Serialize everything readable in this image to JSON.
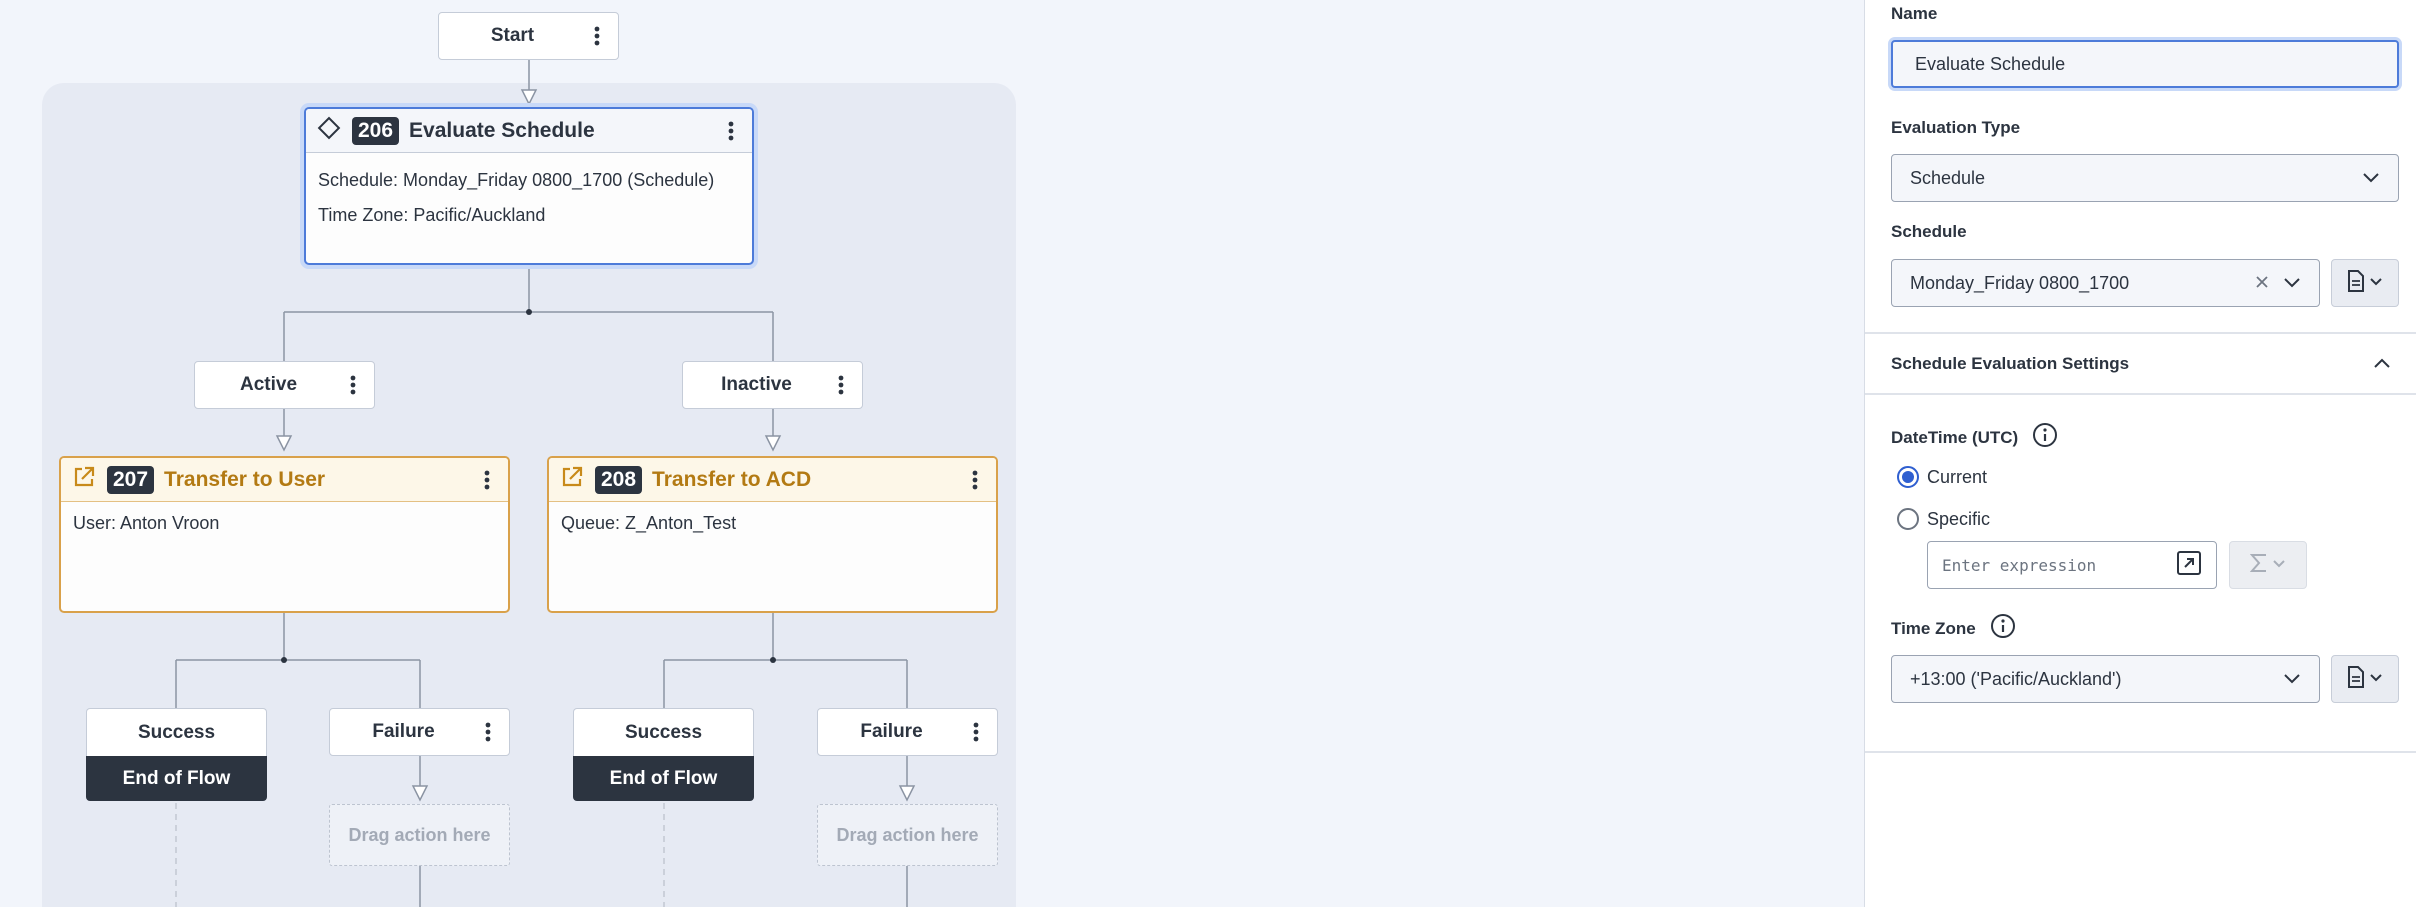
{
  "canvas": {
    "start": {
      "label": "Start"
    },
    "evaluate": {
      "number": "206",
      "title": "Evaluate Schedule",
      "schedule_line": "Schedule: Monday_Friday 0800_1700 (Schedule)",
      "timezone_line": "Time Zone: Pacific/Auckland"
    },
    "paths": {
      "active": "Active",
      "inactive": "Inactive"
    },
    "transfer_user": {
      "number": "207",
      "title": "Transfer to User",
      "detail": "User: Anton Vroon"
    },
    "transfer_acd": {
      "number": "208",
      "title": "Transfer to ACD",
      "detail": "Queue: Z_Anton_Test"
    },
    "outcomes": {
      "success": "Success",
      "failure": "Failure",
      "end_of_flow": "End of Flow",
      "drag_here": "Drag action here"
    }
  },
  "panel": {
    "name_label": "Name",
    "name_value": "Evaluate Schedule",
    "eval_type_label": "Evaluation Type",
    "eval_type_value": "Schedule",
    "schedule_label": "Schedule",
    "schedule_value": "Monday_Friday 0800_1700",
    "settings_title": "Schedule Evaluation Settings",
    "datetime_label": "DateTime (UTC)",
    "radio_current": "Current",
    "radio_specific": "Specific",
    "expression_placeholder": "Enter expression",
    "timezone_label": "Time Zone",
    "timezone_value": "+13:00 ('Pacific/Auckland')"
  },
  "colors": {
    "accent": "#2f5fd0",
    "transfer": "#b37a13",
    "dark": "#2c3440"
  }
}
